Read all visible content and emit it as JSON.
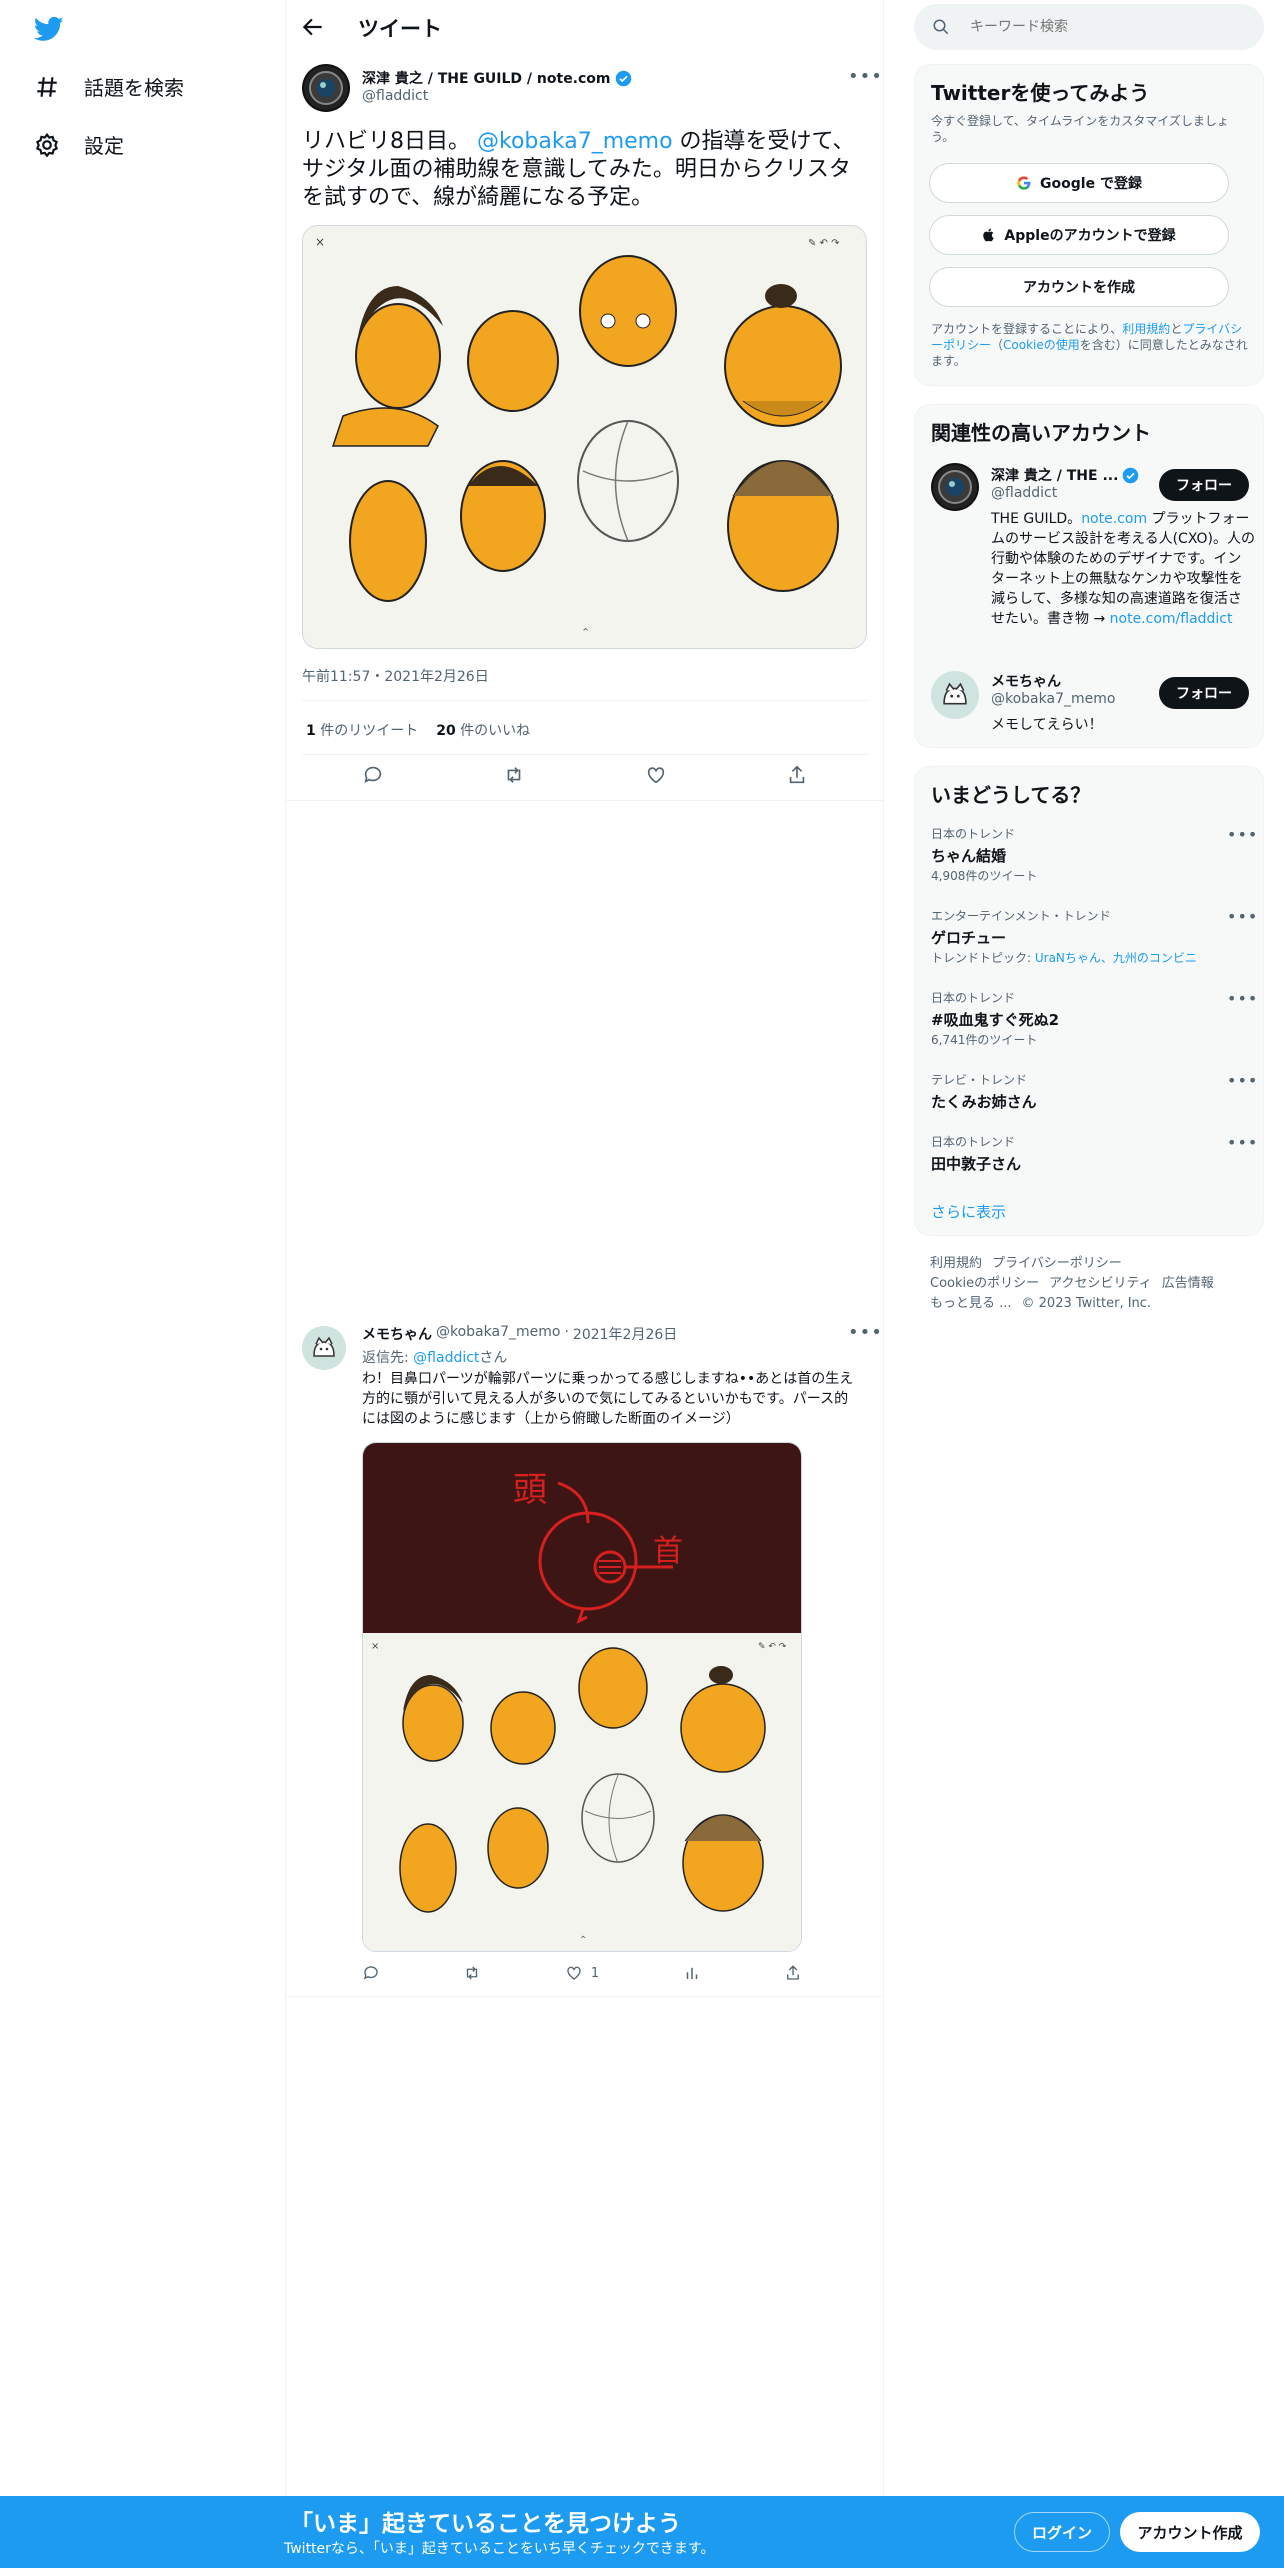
{
  "nav": {
    "explore_label": "話題を検索",
    "settings_label": "設定"
  },
  "header": {
    "title": "ツイート"
  },
  "main_tweet": {
    "author_name": "深津 貴之 / THE GUILD / note.com",
    "handle": "@fladdict",
    "text_before": "リハビリ8日目。 ",
    "mention": "@kobaka7_memo",
    "text_after": " の指導を受けて、サジタル面の補助線を意識してみた。明日からクリスタを試すので、線が綺麗になる予定。",
    "timestamp": "午前11:57・2021年2月26日",
    "retweet_count": "1",
    "retweet_label": "件のリツイート",
    "like_count": "20",
    "like_label": "件のいいね",
    "more": "•••"
  },
  "reply_tweet": {
    "author_name": "メモちゃん",
    "handle": "@kobaka7_memo",
    "date": "2021年2月26日",
    "reply_to_prefix": "返信先: ",
    "reply_to_handle": "@fladdict",
    "reply_to_suffix": "さん",
    "text": "わ！目鼻口パーツが輪郭パーツに乗っかってる感じしますね••あとは首の生え方的に顎が引いて見える人が多いので気にしてみるといいかもです。パース的には図のように感じます（上から俯瞰した断面のイメージ）",
    "like_count": "1",
    "annotation_head": "頭",
    "annotation_neck": "首"
  },
  "search": {
    "placeholder": "キーワード検索"
  },
  "signup_card": {
    "title": "Twitterを使ってみよう",
    "subtitle": "今すぐ登録して、タイムラインをカスタマイズしましょう。",
    "google_label": "Google で登録",
    "apple_label": "Appleのアカウントで登録",
    "create_label": "アカウントを作成",
    "legal_1": "アカウントを登録することにより、",
    "legal_terms": "利用規約",
    "legal_2": "と",
    "legal_privacy": "プライバシーポリシー",
    "legal_3": "（",
    "legal_cookie": "Cookieの使用",
    "legal_4": "を含む）に同意したとみなされます。"
  },
  "related_card": {
    "title": "関連性の高いアカウント",
    "accounts": [
      {
        "name": "深津 貴之 / THE ...",
        "handle": "@fladdict",
        "follow": "フォロー",
        "bio_1": "THE GUILD。",
        "bio_link": "note.com",
        "bio_2": " プラットフォームのサービス設計を考える人(CXO)。人の行動や体験のためのデザイナです。インターネット上の無駄なケンカや攻撃性を減らして、多様な知の高速道路を復活させたい。書き物 → ",
        "bio_link2": "note.com/fladdict"
      },
      {
        "name": "メモちゃん",
        "handle": "@kobaka7_memo",
        "follow": "フォロー",
        "bio_1": "メモしてえらい！"
      }
    ]
  },
  "trends_card": {
    "title": "いまどうしてる？",
    "items": [
      {
        "context": "日本のトレンド",
        "name": "ちゃん結婚",
        "sub": "4,908件のツイート"
      },
      {
        "context": "エンターテインメント・トレンド",
        "name": "ゲロチュー",
        "sub_prefix": "トレンドトピック: ",
        "sub_link": "UraNちゃん、九州のコンビニ"
      },
      {
        "context": "日本のトレンド",
        "name": "#吸血鬼すぐ死ぬ2",
        "sub": "6,741件のツイート"
      },
      {
        "context": "テレビ・トレンド",
        "name": "たくみお姉さん"
      },
      {
        "context": "日本のトレンド",
        "name": "田中敦子さん"
      }
    ],
    "show_more": "さらに表示",
    "more_icon": "•••"
  },
  "footer": {
    "line1": [
      "利用規約",
      "プライバシーポリシー"
    ],
    "line2": [
      "Cookieのポリシー",
      "アクセシビリティ",
      "広告情報"
    ],
    "line3": [
      "もっと見る ...",
      "© 2023 Twitter, Inc."
    ]
  },
  "bottom_bar": {
    "title": "「いま」起きていることを見つけよう",
    "subtitle": "Twitterなら、「いま」起きていることをいち早くチェックできます。",
    "login": "ログイン",
    "signup": "アカウント作成"
  },
  "colors": {
    "accent": "#1d9bf0",
    "orange_fill": "#f2a51f",
    "dark_bg": "#3d1515",
    "red_ink": "#d62020"
  }
}
